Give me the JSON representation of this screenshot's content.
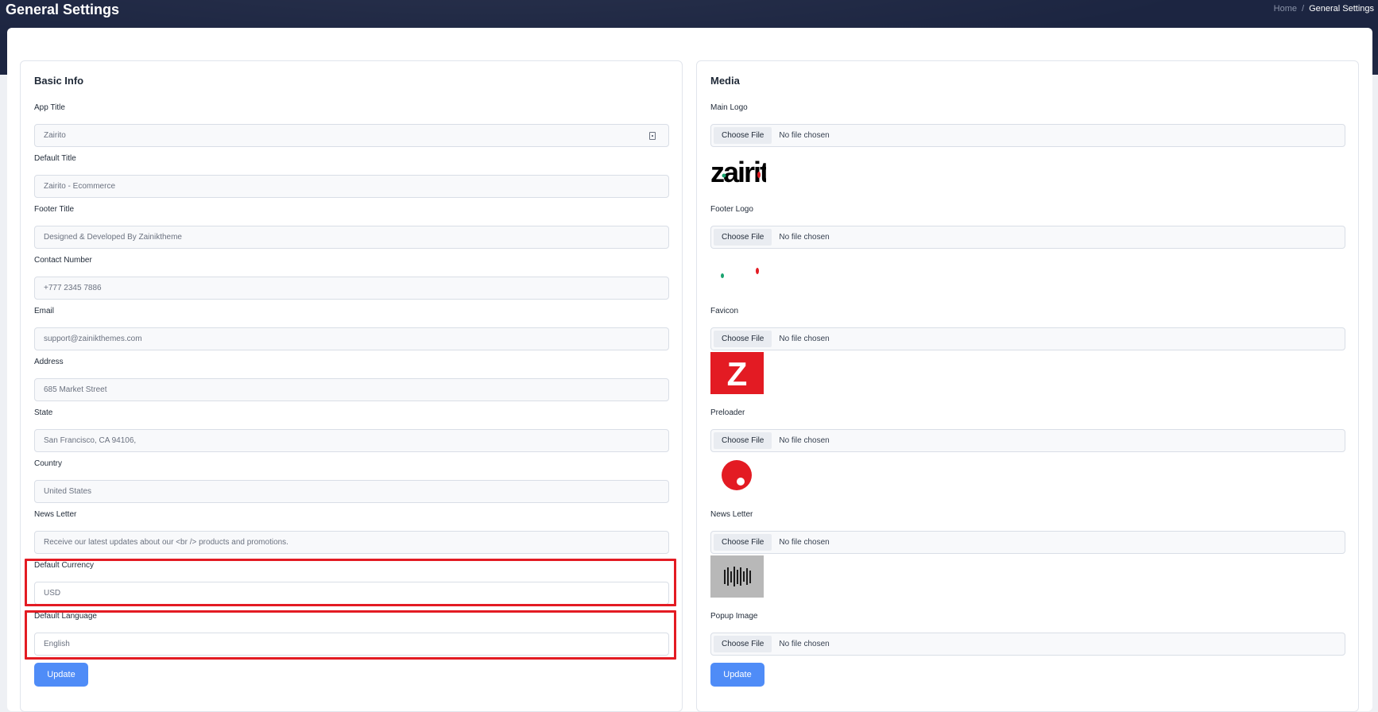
{
  "header": {
    "title": "General Settings",
    "breadcrumb": {
      "home": "Home",
      "separator": "/",
      "current": "General Settings"
    }
  },
  "basic_info": {
    "title": "Basic Info",
    "fields": [
      {
        "label": "App Title",
        "value": "Zairito"
      },
      {
        "label": "Default Title",
        "value": "Zairito - Ecommerce"
      },
      {
        "label": "Footer Title",
        "value": "Designed & Developed By Zainiktheme"
      },
      {
        "label": "Contact Number",
        "value": "+777 2345 7886"
      },
      {
        "label": "Email",
        "value": "support@zainikthemes.com"
      },
      {
        "label": "Address",
        "value": "685 Market Street"
      },
      {
        "label": "State",
        "value": "San Francisco, CA 94106,"
      },
      {
        "label": "Country",
        "value": "United States"
      },
      {
        "label": "News Letter",
        "value": "Receive our latest updates about our <br /> products and promotions."
      },
      {
        "label": "Default Currency",
        "value": "USD"
      },
      {
        "label": "Default Language",
        "value": "English"
      }
    ],
    "update_label": "Update"
  },
  "media": {
    "title": "Media",
    "choose_file_label": "Choose File",
    "no_file_label": "No file chosen",
    "fields": [
      {
        "label": "Main Logo",
        "preview_text": "zairito"
      },
      {
        "label": "Footer Logo"
      },
      {
        "label": "Favicon",
        "preview_text": "Z"
      },
      {
        "label": "Preloader"
      },
      {
        "label": "News Letter"
      },
      {
        "label": "Popup Image"
      }
    ],
    "update_label": "Update"
  },
  "colors": {
    "header_bg": "#1c2541",
    "primary_button": "#4f8cf7",
    "highlight": "#e31b23",
    "brand_red": "#e31b23",
    "brand_green": "#1aa36f"
  }
}
